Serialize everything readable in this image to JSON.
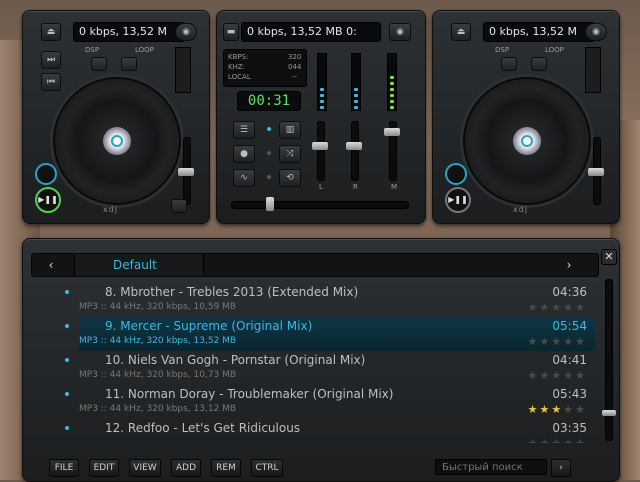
{
  "deck_left": {
    "display": "0 kbps, 13,52 M",
    "logo": "xdj",
    "labels": [
      "DSP",
      "LOOP"
    ]
  },
  "mixer": {
    "display": "0 kbps, 13,52 MB 0:",
    "info": {
      "kbps_label": "KBPS:",
      "kbps_value": "320",
      "khz_label": "KHZ:",
      "khz_value": "044",
      "source": "LOCAL",
      "source_value": "--"
    },
    "time": "00:31",
    "channel_labels": [
      "L",
      "R",
      "M"
    ]
  },
  "deck_right": {
    "display": "0 kbps, 13,52 M",
    "logo": "xdj",
    "labels": [
      "DSP",
      "LOOP"
    ]
  },
  "playlist": {
    "tab": "Default",
    "tracks": [
      {
        "title": "8. Mbrother - Trebles 2013 (Extended Mix)",
        "time": "04:36",
        "meta": "",
        "rating": 0,
        "active": false
      },
      {
        "title": "9. Mercer - Supreme (Original Mix)",
        "time": "05:54",
        "meta": "MP3 :: 44 kHz, 320 kbps, 13,52 MB",
        "rating": 0,
        "active": true
      },
      {
        "title": "10. Niels Van Gogh - Pornstar (Original Mix)",
        "time": "04:41",
        "meta": "MP3 :: 44 kHz, 320 kbps, 10,73 MB",
        "rating": 0,
        "active": false
      },
      {
        "title": "11. Norman Doray - Troublemaker (Original Mix)",
        "time": "05:43",
        "meta": "MP3 :: 44 kHz, 320 kbps, 13,12 MB",
        "rating": 3,
        "active": false
      },
      {
        "title": "12. Redfoo - Let's Get Ridiculous",
        "time": "03:35",
        "meta": "",
        "rating": 0,
        "active": false
      }
    ],
    "extra_meta_8": "MP3 :: 44 kHz, 320 kbps, 10,59 MB",
    "footer_buttons": [
      "FILE",
      "EDIT",
      "VIEW",
      "ADD",
      "REM",
      "CTRL"
    ],
    "search_placeholder": "Быстрый поиск"
  },
  "colors": {
    "accent": "#3fb7e0",
    "play": "#4fd14f",
    "star": "#f0c437"
  }
}
